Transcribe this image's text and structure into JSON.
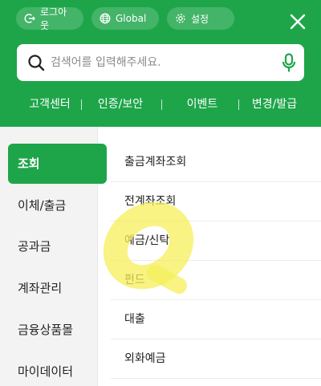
{
  "header": {
    "background_color": "#1ea54a",
    "pills": [
      {
        "label": "로그아웃",
        "icon": "logout-icon"
      },
      {
        "label": "Global",
        "icon": "globe-icon"
      },
      {
        "label": "설정",
        "icon": "gear-icon"
      }
    ],
    "close_icon": "close-icon"
  },
  "search": {
    "placeholder": "검색어를 입력해주세요.",
    "search_icon": "search-icon",
    "mic_icon": "microphone-icon"
  },
  "quick_links": [
    "고객센터",
    "인증/보안",
    "이벤트",
    "변경/발급"
  ],
  "left_menu": {
    "active_index": 0,
    "items": [
      "조회",
      "이체/출금",
      "공과금",
      "계좌관리",
      "금융상품몰",
      "마이데이터"
    ]
  },
  "right_menu": {
    "items": [
      "출금계좌조회",
      "전계좌조회",
      "예금/신탁",
      "펀드",
      "대출",
      "외화예금"
    ]
  },
  "overlay": {
    "highlight_color": "#f5ef5a"
  }
}
